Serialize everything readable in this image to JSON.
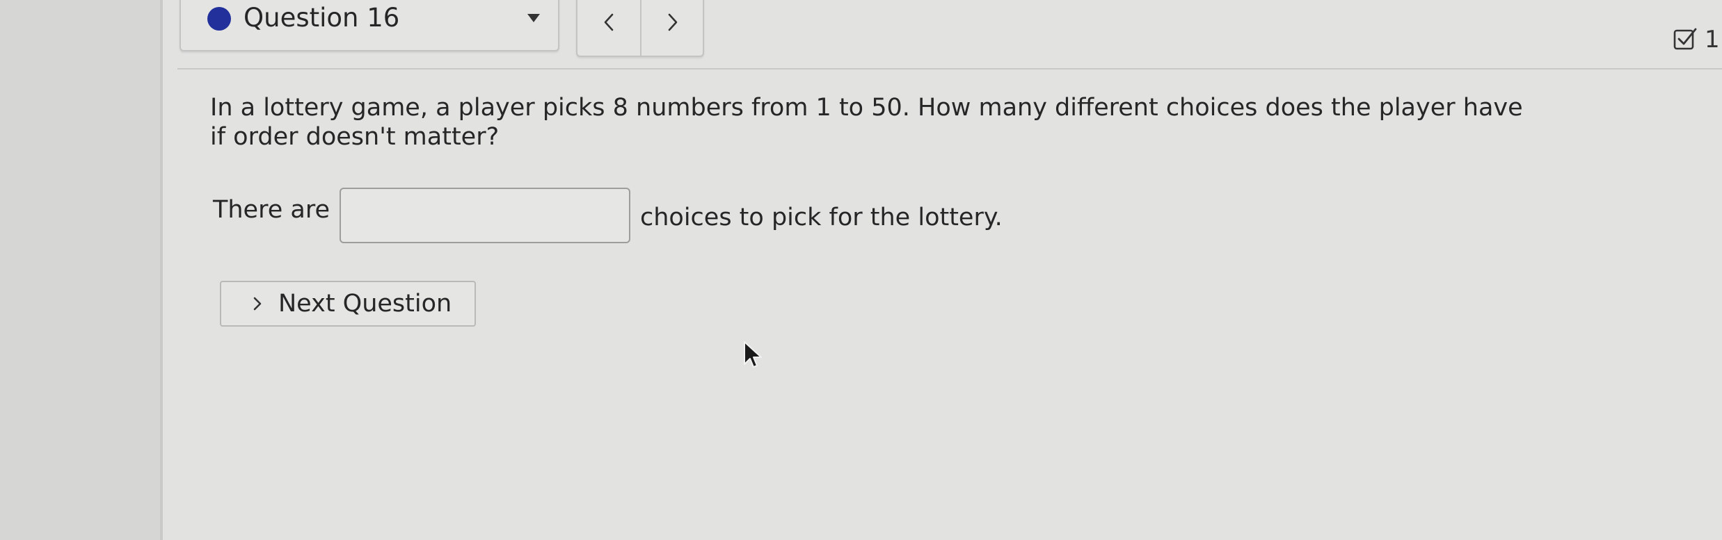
{
  "header": {
    "question_selector": {
      "label": "Question 16",
      "status_color": "#22309b"
    },
    "pager": {
      "prev_icon": "chevron-left-icon",
      "next_icon": "chevron-right-icon"
    },
    "progress": {
      "icon": "checkbox-checked-icon",
      "count": "1"
    }
  },
  "question": {
    "prompt": "In a lottery game, a player picks 8 numbers from 1 to 50. How many different choices does the player have if order doesn't matter?",
    "answer_prefix": "There are",
    "answer_value": "",
    "answer_suffix": "choices to pick for the lottery."
  },
  "actions": {
    "next_question_label": "Next Question"
  }
}
